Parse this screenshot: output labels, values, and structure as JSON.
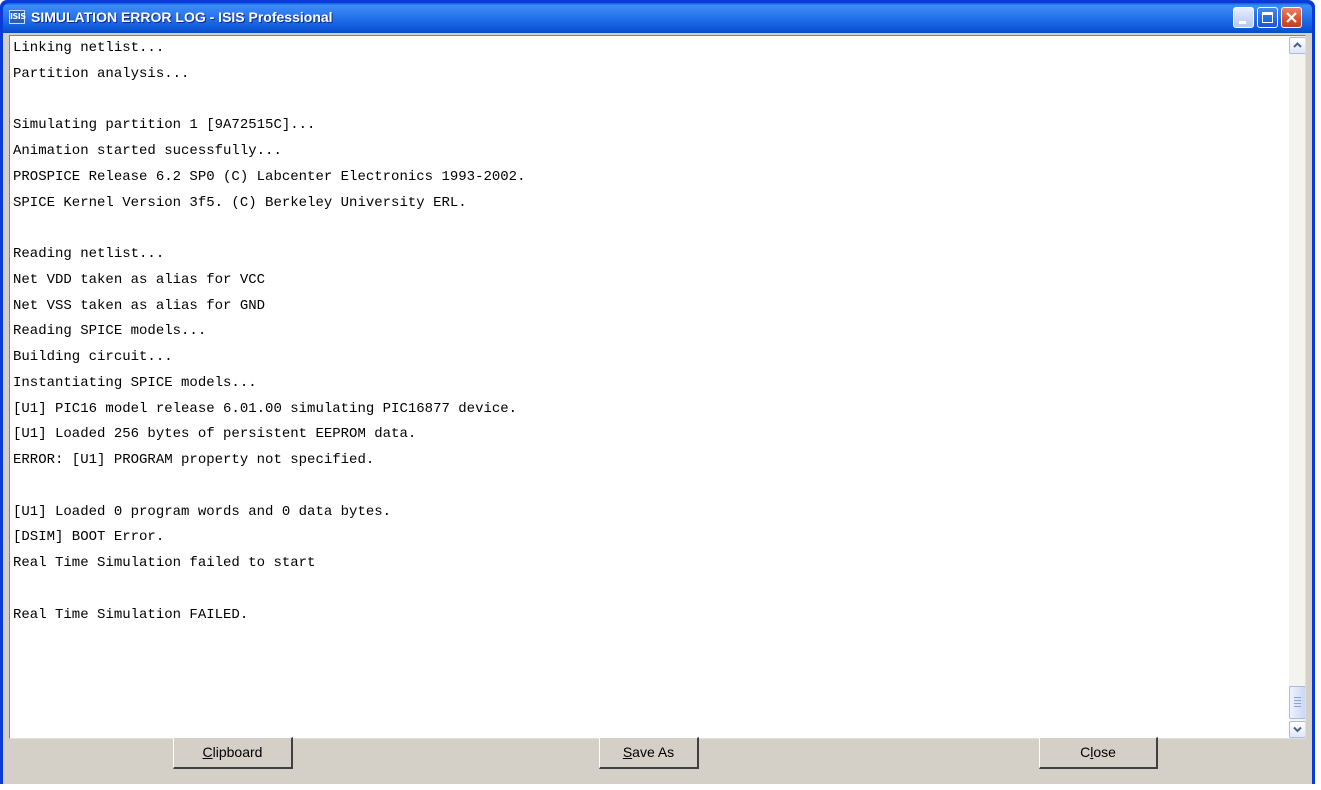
{
  "window": {
    "title": "SIMULATION ERROR LOG - ISIS Professional",
    "icon": "isis-app-icon",
    "icon_text": "ISIS"
  },
  "log": {
    "lines": [
      "Linking netlist...",
      "Partition analysis...",
      "",
      "Simulating partition 1 [9A72515C]...",
      "Animation started sucessfully...",
      "PROSPICE Release 6.2 SP0 (C) Labcenter Electronics 1993-2002.",
      "SPICE Kernel Version 3f5. (C) Berkeley University ERL.",
      "",
      "Reading netlist...",
      "Net VDD taken as alias for VCC",
      "Net VSS taken as alias for GND",
      "Reading SPICE models...",
      "Building circuit...",
      "Instantiating SPICE models...",
      "[U1] PIC16 model release 6.01.00 simulating PIC16877 device.",
      "[U1] Loaded 256 bytes of persistent EEPROM data.",
      "ERROR: [U1] PROGRAM property not specified.",
      "",
      "[U1] Loaded 0 program words and 0 data bytes.",
      "[DSIM] BOOT Error.",
      "Real Time Simulation failed to start",
      "",
      "Real Time Simulation FAILED."
    ]
  },
  "buttons": {
    "clipboard": {
      "mnemonic": "C",
      "rest": "lipboard"
    },
    "save_as": {
      "mnemonic": "S",
      "rest": "ave As"
    },
    "close": {
      "pre": "C",
      "mnemonic": "l",
      "rest": "ose"
    }
  },
  "colors": {
    "titlebar": "#2b77ee",
    "face": "#d4d0c8",
    "close_button": "#d7502c"
  }
}
